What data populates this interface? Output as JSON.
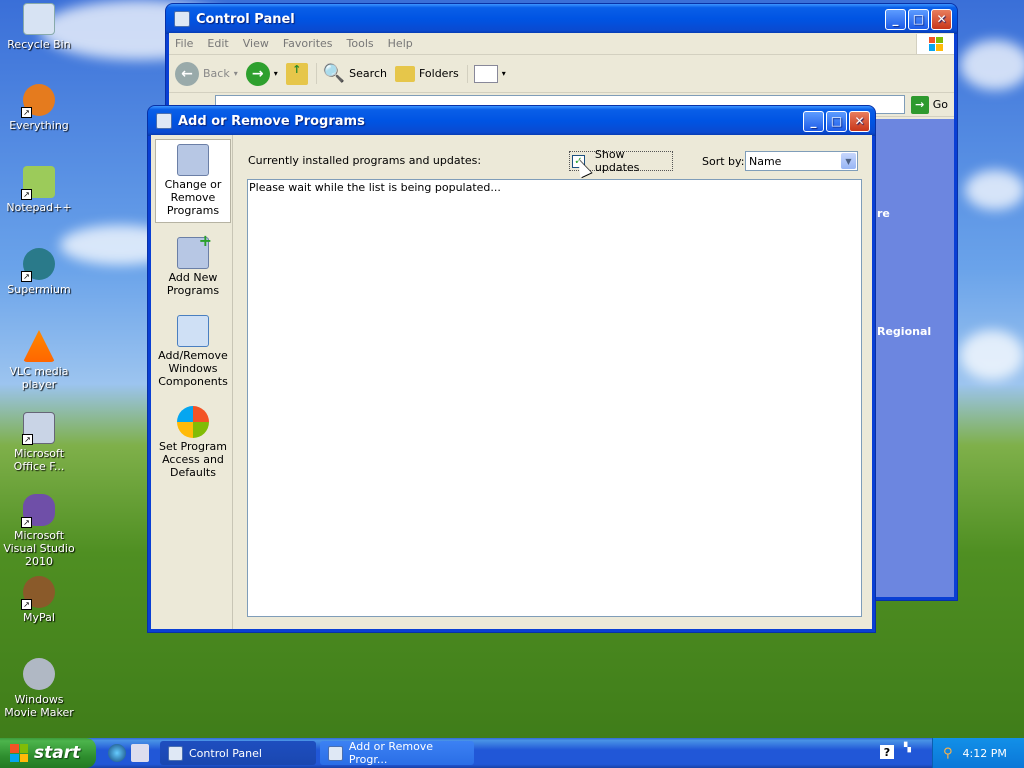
{
  "desktop_icons": [
    {
      "label": "Recycle Bin",
      "icon": "recycle-bin-icon"
    },
    {
      "label": "Everything",
      "icon": "everything-icon"
    },
    {
      "label": "Notepad++",
      "icon": "notepad-plus-plus-icon"
    },
    {
      "label": "Supermium",
      "icon": "supermium-icon"
    },
    {
      "label": "VLC media player",
      "icon": "vlc-icon"
    },
    {
      "label": "Microsoft Office F...",
      "icon": "office-icon"
    },
    {
      "label": "Microsoft Visual Studio 2010",
      "icon": "visual-studio-icon"
    },
    {
      "label": "MyPal",
      "icon": "mypal-icon"
    },
    {
      "label": "Windows Movie Maker",
      "icon": "movie-maker-icon"
    }
  ],
  "control_panel": {
    "title": "Control Panel",
    "menu": [
      "File",
      "Edit",
      "View",
      "Favorites",
      "Tools",
      "Help"
    ],
    "toolbar": {
      "back": "Back",
      "search": "Search",
      "folders": "Folders"
    },
    "go": "Go",
    "background_text": [
      "re",
      "Regional"
    ]
  },
  "add_remove": {
    "title": "Add or Remove Programs",
    "sidebar": [
      {
        "label": "Change or Remove Programs",
        "selected": true
      },
      {
        "label": "Add New Programs",
        "selected": false
      },
      {
        "label": "Add/Remove Windows Components",
        "selected": false
      },
      {
        "label": "Set Program Access and Defaults",
        "selected": false
      }
    ],
    "installed_label": "Currently installed programs and updates:",
    "show_updates": "Show updates",
    "show_updates_checked": true,
    "sort_by_label": "Sort by:",
    "sort_by_value": "Name",
    "list_message": "Please wait while the list is being populated..."
  },
  "taskbar": {
    "start": "start",
    "tasks": [
      "Control Panel",
      "Add or Remove Progr..."
    ],
    "clock": "4:12 PM"
  }
}
